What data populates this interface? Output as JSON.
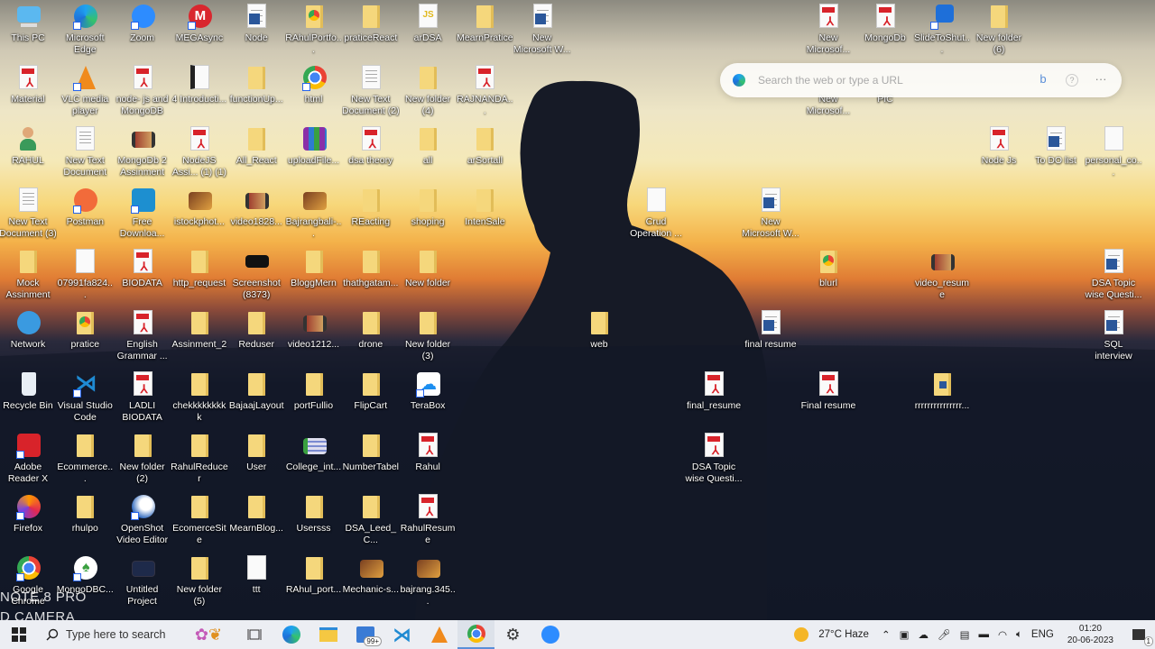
{
  "desktop": {
    "grid": [
      [
        {
          "label": "This PC",
          "icon": "pc"
        },
        {
          "label": "Microsoft Edge",
          "icon": "edge"
        },
        {
          "label": "Zoom",
          "icon": "zoom"
        },
        {
          "label": "MEGAsync",
          "icon": "mega"
        },
        {
          "label": "Node",
          "icon": "word"
        },
        {
          "label": "RAhulPortfo...",
          "icon": "chrome-file"
        },
        {
          "label": "praticeReact",
          "icon": "folder"
        },
        {
          "label": "arDSA",
          "icon": "js"
        },
        {
          "label": "MearnPratice",
          "icon": "folder"
        },
        {
          "label": "New Microsoft W...",
          "icon": "word"
        }
      ],
      [
        {
          "label": "Material",
          "icon": "pdf"
        },
        {
          "label": "VLC media player",
          "icon": "vlc"
        },
        {
          "label": "node- js and MongoDB",
          "icon": "pdf"
        },
        {
          "label": "4 Introducti...",
          "icon": "file-dark"
        },
        {
          "label": "functionUp...",
          "icon": "folder"
        },
        {
          "label": "html",
          "icon": "chrome"
        },
        {
          "label": "New Text Document (2)",
          "icon": "txt"
        },
        {
          "label": "New folder (4)",
          "icon": "folder"
        },
        {
          "label": "RAJNANDA...",
          "icon": "pdf"
        }
      ],
      [
        {
          "label": "RAHUL",
          "icon": "user"
        },
        {
          "label": "New Text Document",
          "icon": "txt"
        },
        {
          "label": "MongoDb 2 Assinment",
          "icon": "video"
        },
        {
          "label": "NodeJS Assi... (1) (1)",
          "icon": "pdf"
        },
        {
          "label": "All_React",
          "icon": "folder"
        },
        {
          "label": "uploadFile...",
          "icon": "rar"
        },
        {
          "label": "dsa theory",
          "icon": "pdf"
        },
        {
          "label": "all",
          "icon": "folder"
        },
        {
          "label": "arSortall",
          "icon": "folder"
        }
      ],
      [
        {
          "label": "New Text Document (3)",
          "icon": "txt"
        },
        {
          "label": "Postman",
          "icon": "postman"
        },
        {
          "label": "Free Downloa...",
          "icon": "download"
        },
        {
          "label": "istockphot...",
          "icon": "image"
        },
        {
          "label": "video1828...",
          "icon": "video"
        },
        {
          "label": "Bajrangbali-...",
          "icon": "image"
        },
        {
          "label": "REacting",
          "icon": "folder"
        },
        {
          "label": "shoping",
          "icon": "folder"
        },
        {
          "label": "IntenSale",
          "icon": "folder"
        }
      ],
      [
        {
          "label": "Mock Assinment",
          "icon": "folder"
        },
        {
          "label": "07991fa824...",
          "icon": "file"
        },
        {
          "label": "BIODATA",
          "icon": "pdf"
        },
        {
          "label": "http_request",
          "icon": "folder"
        },
        {
          "label": "Screenshot (8373)",
          "icon": "screenshot"
        },
        {
          "label": "BloggMern",
          "icon": "folder"
        },
        {
          "label": "thathgatam...",
          "icon": "folder"
        },
        {
          "label": "New folder",
          "icon": "folder"
        }
      ],
      [
        {
          "label": "Network",
          "icon": "network"
        },
        {
          "label": "pratice",
          "icon": "chrome-file"
        },
        {
          "label": "English Grammar ...",
          "icon": "pdf"
        },
        {
          "label": "Assinment_2",
          "icon": "folder"
        },
        {
          "label": "Reduser",
          "icon": "folder"
        },
        {
          "label": "video1212...",
          "icon": "video"
        },
        {
          "label": "drone",
          "icon": "folder"
        },
        {
          "label": "New folder (3)",
          "icon": "folder"
        }
      ],
      [
        {
          "label": "Recycle Bin",
          "icon": "bin"
        },
        {
          "label": "Visual Studio Code",
          "icon": "vscode"
        },
        {
          "label": "LADLI BIODATA",
          "icon": "pdf"
        },
        {
          "label": "chekkkkkkkkk",
          "icon": "folder"
        },
        {
          "label": "BajaajLayout",
          "icon": "folder"
        },
        {
          "label": "portFullio",
          "icon": "folder"
        },
        {
          "label": "FlipCart",
          "icon": "folder"
        },
        {
          "label": "TeraBox",
          "icon": "terabox"
        }
      ],
      [
        {
          "label": "Adobe Reader X",
          "icon": "adobe"
        },
        {
          "label": "Ecommerce...",
          "icon": "folder"
        },
        {
          "label": "New folder (2)",
          "icon": "folder"
        },
        {
          "label": "RahulReducer",
          "icon": "folder"
        },
        {
          "label": "User",
          "icon": "folder"
        },
        {
          "label": "College_int...",
          "icon": "sheet"
        },
        {
          "label": "NumberTabel",
          "icon": "folder"
        },
        {
          "label": "Rahul",
          "icon": "pdf"
        }
      ],
      [
        {
          "label": "Firefox",
          "icon": "firefox"
        },
        {
          "label": "rhulpo",
          "icon": "folder"
        },
        {
          "label": "OpenShot Video Editor",
          "icon": "openshot"
        },
        {
          "label": "EcomerceSite",
          "icon": "folder"
        },
        {
          "label": "MearnBlog...",
          "icon": "folder"
        },
        {
          "label": "Usersss",
          "icon": "folder"
        },
        {
          "label": "DSA_Leed_C...",
          "icon": "folder"
        },
        {
          "label": "RahulResume",
          "icon": "pdf"
        }
      ],
      [
        {
          "label": "Google Chrome",
          "icon": "chrome"
        },
        {
          "label": "MongoDBC...",
          "icon": "mongo"
        },
        {
          "label": "Untitled Project",
          "icon": "video-dark"
        },
        {
          "label": "New folder (5)",
          "icon": "folder"
        },
        {
          "label": "ttt",
          "icon": "file"
        },
        {
          "label": "RAhul_port...",
          "icon": "folder"
        },
        {
          "label": "Mechanic-s...",
          "icon": "image"
        },
        {
          "label": "bajrang.345...",
          "icon": "image"
        }
      ]
    ],
    "extra": [
      {
        "label": "New Microsof...",
        "icon": "pdf"
      },
      {
        "label": "MongoDb",
        "icon": "pdf"
      },
      {
        "label": "SlideToShut...",
        "icon": "shortcut"
      },
      {
        "label": "New folder (6)",
        "icon": "folder"
      },
      {
        "label": "New Microsof...",
        "icon": "none"
      },
      {
        "label": "PIC",
        "icon": "none"
      },
      {
        "label": "Node Js",
        "icon": "pdf"
      },
      {
        "label": "To DO list",
        "icon": "word"
      },
      {
        "label": "personal_co...",
        "icon": "file"
      },
      {
        "label": "Crud Operation ...",
        "icon": "file"
      },
      {
        "label": "New Microsoft W...",
        "icon": "word"
      },
      {
        "label": "blurl",
        "icon": "chrome-file"
      },
      {
        "label": "video_resume",
        "icon": "video"
      },
      {
        "label": "DSA Topic wise Questi...",
        "icon": "word"
      },
      {
        "label": "web",
        "icon": "folder"
      },
      {
        "label": "final resume",
        "icon": "word"
      },
      {
        "label": "SQL interview question an...",
        "icon": "word"
      },
      {
        "label": "final_resume",
        "icon": "pdf"
      },
      {
        "label": "Final resume",
        "icon": "pdf"
      },
      {
        "label": "rrrrrrrrrrrrrrr...",
        "icon": "word-file"
      },
      {
        "label": "DSA Topic wise Questi...",
        "icon": "pdf"
      }
    ]
  },
  "edge_bar": {
    "placeholder": "Search the web or type a URL"
  },
  "watermark": {
    "line1": "NOTE 8 PRO",
    "line2": "D CAMERA"
  },
  "taskbar": {
    "search_placeholder": "Type here to search",
    "store_badge": "99+",
    "weather": "27°C Haze",
    "lang": "ENG",
    "time": "01:20",
    "date": "20-06-2023",
    "notif_count": "1"
  },
  "colors": {
    "taskbar": "#eceef3",
    "folder": "#f5d77c",
    "pdf": "#d8232a",
    "word": "#2b579a"
  }
}
